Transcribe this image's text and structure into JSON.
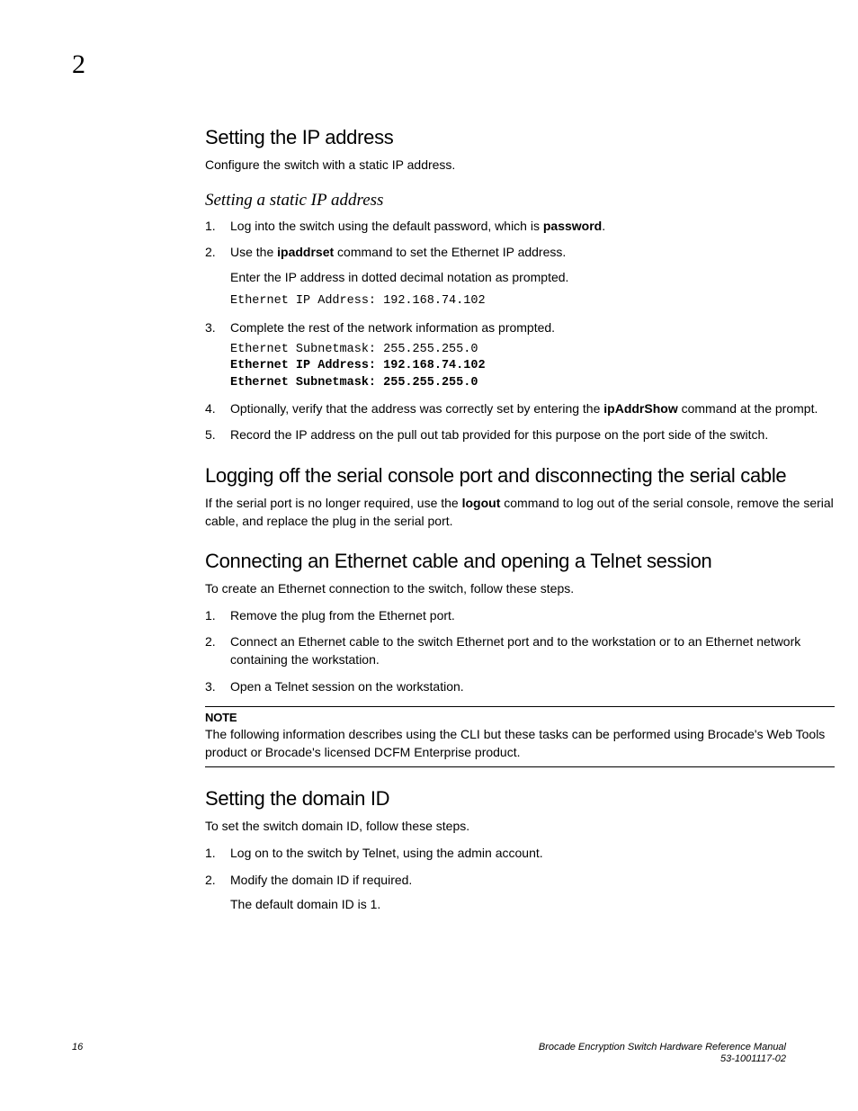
{
  "chapter_number": "2",
  "sections": {
    "ip": {
      "heading": "Setting the IP address",
      "intro": "Configure the switch with a static IP address.",
      "sub_heading": "Setting a static IP address",
      "steps": {
        "s1a": "Log into the switch using the default password, which is ",
        "s1b": "password",
        "s1c": ".",
        "s2a": "Use the ",
        "s2b": "ipaddrset",
        "s2c": " command to set the Ethernet IP address.",
        "s2_sub": "Enter the IP address in dotted decimal notation as prompted.",
        "s2_code": "Ethernet IP Address: 192.168.74.102",
        "s3": "Complete the rest of the network information as prompted.",
        "s3_code_line1": "Ethernet Subnetmask: 255.255.255.0",
        "s3_code_line2": "Ethernet IP Address: 192.168.74.102",
        "s3_code_line3": "Ethernet Subnetmask: 255.255.255.0",
        "s4a": "Optionally, verify that the address was correctly set by entering the ",
        "s4b": "ipAddrShow",
        "s4c": " command at the prompt.",
        "s5": "Record the IP address on the pull out tab provided for this purpose on the port side of the switch."
      }
    },
    "logoff": {
      "heading": "Logging off the serial console port and disconnecting the serial cable",
      "body_a": "If the serial port is no longer required, use the ",
      "body_b": "logout",
      "body_c": " command to log out of the serial console, remove the serial cable, and replace the plug in the serial port."
    },
    "ethernet": {
      "heading": "Connecting an Ethernet cable and opening a Telnet session",
      "intro": "To create an Ethernet connection to the switch, follow these steps.",
      "steps": {
        "s1": "Remove the plug from the Ethernet port.",
        "s2": "Connect an Ethernet cable to the switch Ethernet port and to the workstation or to an Ethernet network containing the workstation.",
        "s3": "Open a Telnet session on the workstation."
      },
      "note_label": "NOTE",
      "note_body": "The following information describes using the CLI but these tasks can be performed using Brocade's Web Tools product or Brocade's licensed DCFM Enterprise product."
    },
    "domain": {
      "heading": "Setting the domain ID",
      "intro": "To set the switch domain ID, follow these steps.",
      "steps": {
        "s1": "Log on to the switch by Telnet, using the admin account.",
        "s2": "Modify the domain ID if required.",
        "s2_sub": "The default domain ID is 1."
      }
    }
  },
  "footer": {
    "page_number": "16",
    "doc_title": "Brocade Encryption Switch Hardware Reference Manual",
    "doc_id": "53-1001117-02"
  }
}
